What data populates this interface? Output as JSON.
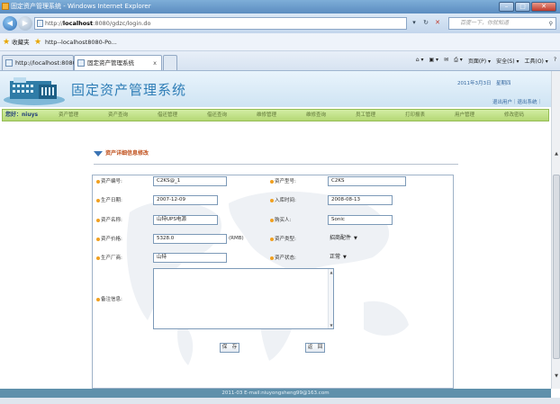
{
  "window": {
    "title": "固定资产管理系统 - Windows Internet Explorer"
  },
  "browser": {
    "url_prefix": "http://",
    "url_host": "localhost",
    "url_rest": ":8080/gdzc/login.do",
    "search_placeholder": "百度一下，你就知道",
    "favorites_label": "收藏夹",
    "favorite_link": "http--localhost8080-Po...",
    "tabs": [
      {
        "label": "http://localhost:8080/Po..."
      },
      {
        "label": "固定资产管理系统"
      }
    ],
    "tools": {
      "page": "页面(P) ▾",
      "safety": "安全(S) ▾",
      "tools": "工具(O) ▾"
    }
  },
  "header": {
    "brand": "固定资产管理系统",
    "date": "2011年3月3日　星期四",
    "user_links": "退出用户｜退出系统｜"
  },
  "menu": {
    "greeting": "您好：niuys",
    "items": [
      "资产管理",
      "资产查询",
      "借还管理",
      "借还查询",
      "维修管理",
      "维修查询",
      "员工管理",
      "打印报表",
      "用户管理",
      "修改密码"
    ]
  },
  "panel": {
    "title": "资产详细信息修改"
  },
  "form": {
    "asset_no_label": "资产编号:",
    "asset_no": "C2KS@_1",
    "model_label": "资产型号:",
    "model": "C2KS",
    "produced_label": "生产日期:",
    "produced": "2007-12-09",
    "stored_label": "入库时间:",
    "stored": "2008-08-13",
    "name_label": "资产名称:",
    "name": "山特UPS电源",
    "buyer_label": "购买人:",
    "buyer": "Sonic",
    "price_label": "资产价格:",
    "price": "5328.0",
    "price_unit": "(RMB)",
    "type_label": "资产类型:",
    "type": "招商配件",
    "maker_label": "生产厂商:",
    "maker": "山特",
    "status_label": "资产状态:",
    "status": "正常",
    "notes_label": "备注信息:"
  },
  "buttons": {
    "save": "保　存",
    "back": "返　回"
  },
  "footer": {
    "text": "2011-03 E-mail:niuyongsheng99@163.com"
  },
  "colors": {
    "menu_green": "#b4d874",
    "brand_blue": "#2e7db6",
    "footer": "#5f90ab",
    "title_orange": "#c0501c"
  }
}
